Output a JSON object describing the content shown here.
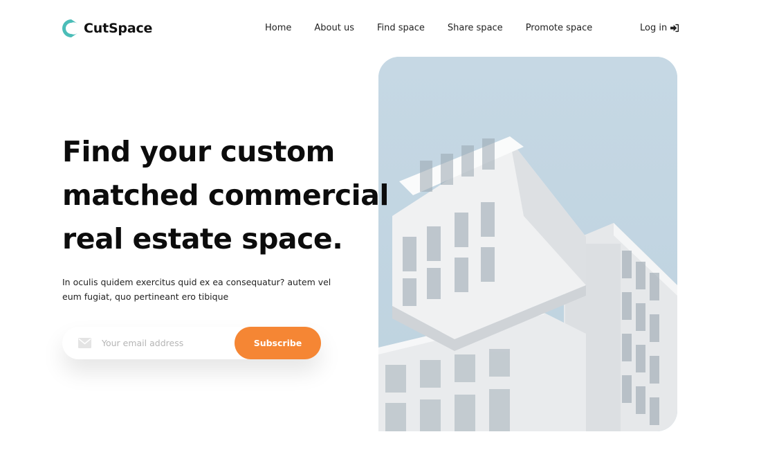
{
  "brand": {
    "name": "CutSpace",
    "logo_color": "#4bbdb8"
  },
  "nav": {
    "items": [
      {
        "label": "Home"
      },
      {
        "label": "About us"
      },
      {
        "label": "Find space"
      },
      {
        "label": "Share space"
      },
      {
        "label": "Promote space"
      }
    ],
    "login_label": "Log in",
    "login_icon": "sign-in-icon"
  },
  "hero": {
    "headline": "Find your custom matched commercial real estate space.",
    "subtext": "In oculis quidem exercitus quid ex ea consequatur? autem vel eum fugiat, quo pertineant ero tibique",
    "email_placeholder": "Your email address",
    "email_value": "",
    "email_icon": "mail-icon",
    "subscribe_label": "Subscribe",
    "accent_color": "#f58634",
    "image_icon": "building-photo"
  }
}
